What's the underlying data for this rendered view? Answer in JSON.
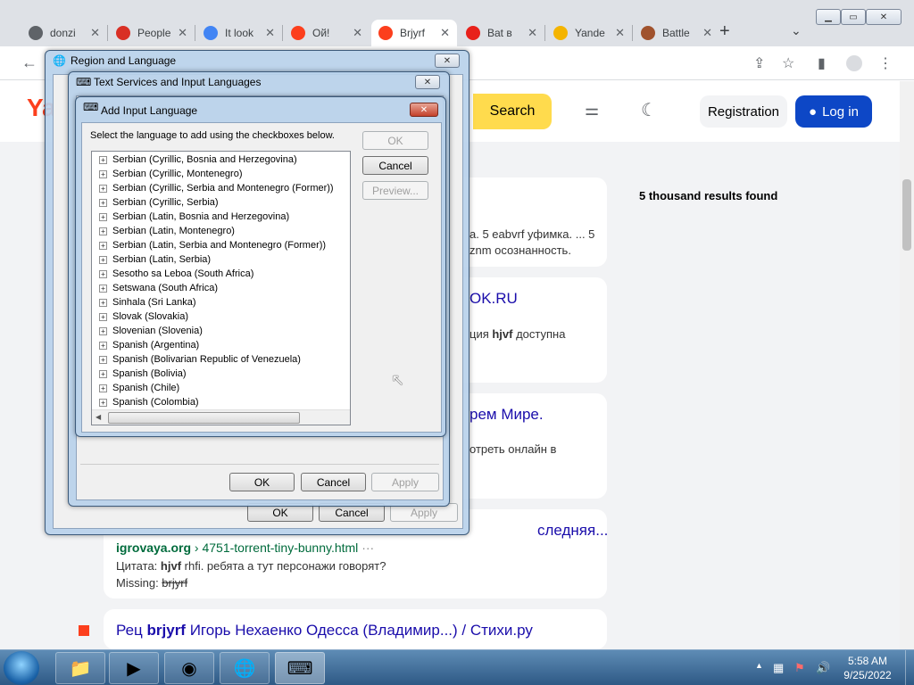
{
  "browser": {
    "tabs": [
      {
        "label": "donzi",
        "icon": "globe-icon",
        "color": "#5f6368"
      },
      {
        "label": "People",
        "icon": "lock-icon",
        "color": "#d93025"
      },
      {
        "label": "It look",
        "icon": "google-icon",
        "color": "#4285f4"
      },
      {
        "label": "Ой!",
        "icon": "yandex-icon",
        "color": "#fc3f1d"
      },
      {
        "label": "Brjyrf",
        "icon": "yandex-browser-icon",
        "color": "#fc3f1d"
      },
      {
        "label": "Bat в",
        "icon": "red-arrow-icon",
        "color": "#e8211b"
      },
      {
        "label": "Yande",
        "icon": "emoji-icon",
        "color": "#f4b400"
      },
      {
        "label": "Battle",
        "icon": "game-icon",
        "color": "#a0522d"
      }
    ],
    "new_tab": "+",
    "tab_menu": "⌄"
  },
  "yandex": {
    "logo": "Ya",
    "search_button": "Search",
    "registration": "Registration",
    "login": "Log in",
    "results_count": "5 thousand results found",
    "snippet1_line1": "а. 5 eabvrf уфимка. ... 5",
    "snippet1_line2": "znm осознанность.",
    "card2_title": "OK.RU",
    "card2_text_prefix": "ция ",
    "card2_text_bold": "hjvf",
    "card2_text_suffix": " доступна",
    "card3_title": "рем Мире.",
    "card3_text": "отреть онлайн в",
    "card4_title": "следняя...",
    "card4_url_bold": "igrovaya.org",
    "card4_url_rest": " › 4751-torrent-tiny-bunny.html",
    "card4_url_more": "···",
    "card4_quote_prefix": "Цитата: ",
    "card4_quote_bold": "hjvf",
    "card4_quote_rest": " rhfi. ребята а тут персонажи говорят?",
    "card4_missing_label": "Missing: ",
    "card4_missing_word": "brjyrf",
    "card5_title_prefix": "Рец ",
    "card5_title_bold": "brjyrf",
    "card5_title_rest": " Игорь Нехаенко Одесса (Владимир...) / Стихи.ру"
  },
  "dialogs": {
    "region": {
      "title": "Region and Language",
      "ok": "OK",
      "cancel": "Cancel",
      "apply": "Apply"
    },
    "text_services": {
      "title": "Text Services and Input Languages",
      "ok": "OK",
      "cancel": "Cancel",
      "apply": "Apply"
    },
    "add_input": {
      "title": "Add Input Language",
      "instructions": "Select the language to add using the checkboxes below.",
      "ok": "OK",
      "cancel": "Cancel",
      "preview": "Preview...",
      "languages": [
        "Serbian (Cyrillic, Bosnia and Herzegovina)",
        "Serbian (Cyrillic, Montenegro)",
        "Serbian (Cyrillic, Serbia and Montenegro (Former))",
        "Serbian (Cyrillic, Serbia)",
        "Serbian (Latin, Bosnia and Herzegovina)",
        "Serbian (Latin, Montenegro)",
        "Serbian (Latin, Serbia and Montenegro (Former))",
        "Serbian (Latin, Serbia)",
        "Sesotho sa Leboa (South Africa)",
        "Setswana (South Africa)",
        "Sinhala (Sri Lanka)",
        "Slovak (Slovakia)",
        "Slovenian (Slovenia)",
        "Spanish (Argentina)",
        "Spanish (Bolivarian Republic of Venezuela)",
        "Spanish (Bolivia)",
        "Spanish (Chile)",
        "Spanish (Colombia)"
      ]
    }
  },
  "taskbar": {
    "time": "5:58 AM",
    "date": "9/25/2022"
  }
}
